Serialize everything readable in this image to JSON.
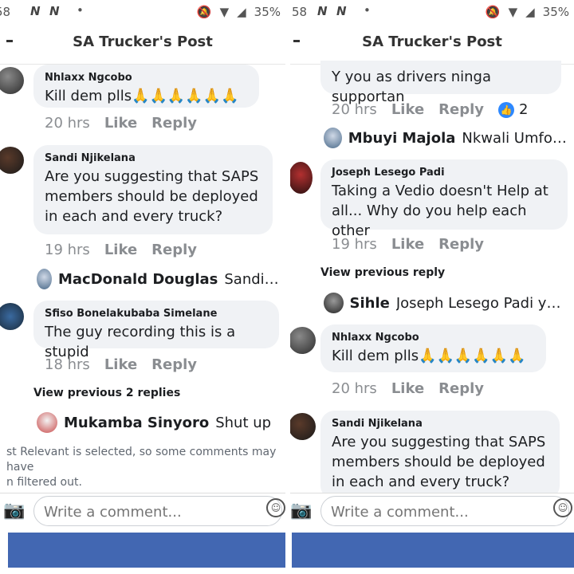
{
  "status_bar": {
    "time_left": "58",
    "time_right": "58",
    "n1": "N",
    "n2": "N",
    "battery": "35%"
  },
  "page_title": "SA Trucker's Post",
  "left": {
    "comments": [
      {
        "author": "Nhlaxx Ngcobo",
        "text": "Kill dem plls🙏🙏🙏🙏🙏🙏",
        "time": "20 hrs"
      },
      {
        "author": "Sandi Njikelana",
        "text": "Are you suggesting that SAPS members should be deployed in each and every truck?",
        "time": "19 hrs"
      },
      {
        "author": "Sfiso Bonelakubaba Simelane",
        "text": "The guy recording this is a stupid",
        "time": "18 hrs"
      }
    ],
    "reply1": {
      "name": "MacDonald Douglas",
      "text": "Sandi Nji..."
    },
    "view_previous": "View previous 2 replies",
    "reply2": {
      "name": "Mukamba Sinyoro",
      "text": "Shut up"
    },
    "notice_line1": "st Relevant is selected, so some comments may have",
    "notice_line2": "n filtered out."
  },
  "right": {
    "top_text": "Y you as drivers ninga supportan",
    "top_time": "20 hrs",
    "top_reactions": "2",
    "reply1": {
      "name": "Mbuyi Majola",
      "text": "Nkwali Umfoka..."
    },
    "comment1": {
      "author": "Joseph Lesego Padi",
      "text": "Taking a Vedio doesn't Help at all... Why do you help each other",
      "time": "19 hrs"
    },
    "view_previous": "View previous reply",
    "reply2": {
      "name": "Sihle",
      "text": "Joseph Lesego Padi you..."
    },
    "comment2": {
      "author": "Nhlaxx Ngcobo",
      "text": "Kill dem plls🙏🙏🙏🙏🙏🙏",
      "time": "20 hrs"
    },
    "comment3": {
      "author": "Sandi Njikelana",
      "text": "Are you suggesting that SAPS members should be deployed in each and every truck?"
    }
  },
  "actions": {
    "like": "Like",
    "reply": "Reply"
  },
  "composer": {
    "placeholder": "Write a comment..."
  },
  "colors": {
    "navbar": "#4267b2",
    "bubble": "#f0f2f5",
    "meta": "#8a8d91",
    "like_blue": "#2d88ff"
  },
  "icons": [
    "back-icon",
    "camera-icon",
    "emoji-icon",
    "like-reaction-icon",
    "mute-icon",
    "wifi-icon",
    "signal-icon"
  ]
}
